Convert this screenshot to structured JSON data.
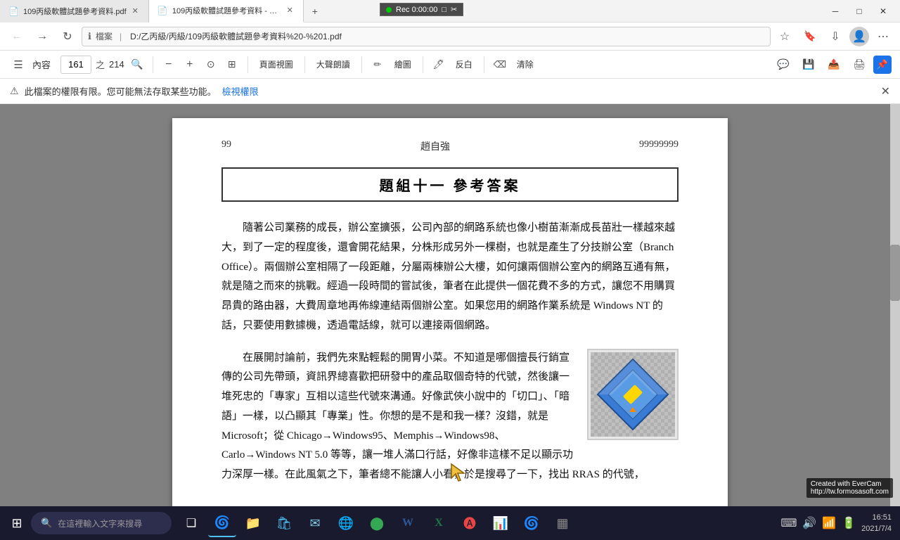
{
  "window": {
    "tabs": [
      {
        "id": "tab1",
        "title": "109丙級軟體試題參考資料.pdf",
        "active": false,
        "icon": "pdf"
      },
      {
        "id": "tab2",
        "title": "109丙級軟體試題參考資料 - 1.p...",
        "active": true,
        "icon": "pdf"
      }
    ],
    "controls": {
      "minimize": "─",
      "maximize": "□",
      "close": "✕"
    }
  },
  "recording": {
    "indicator": "●",
    "time": "Rec 0:00:00",
    "icons": [
      "□",
      "✂"
    ]
  },
  "browser": {
    "back": "←",
    "forward": "→",
    "refresh": "↻",
    "address_label": "檔案",
    "address_info_icon": "ℹ",
    "address_path": "D:/乙丙級/丙級/109丙級軟體試題參考資料%20-%201.pdf",
    "star_icon": "☆",
    "bookmark_icon": "🔖",
    "download_icon": "⬇",
    "profile_icon": "👤",
    "more_icon": "⋯"
  },
  "pdf_toolbar": {
    "sidebar_icon": "☰",
    "sidebar_label": "內容",
    "page_current": "161",
    "page_total": "214",
    "search_icon": "🔍",
    "zoom_out": "−",
    "zoom_in": "+",
    "zoom_fit": "⊙",
    "zoom_width": "⊞",
    "page_view_label": "頁面視圖",
    "read_aloud_label": "大聲朗讀",
    "draw_label": "繪圖",
    "reverse_label": "反白",
    "erase_label": "清除",
    "comment_icon": "💬",
    "save_icon": "💾",
    "share_icon": "📤",
    "print_icon": "🖨",
    "pin_icon": "📌"
  },
  "permission_bar": {
    "icon": "⚠",
    "message": "此檔案的權限有限。您可能無法存取某些功能。",
    "link_text": "檢視權限",
    "close_icon": "✕"
  },
  "pdf_content": {
    "page_left": "99",
    "page_center": "趙自強",
    "page_right": "99999999",
    "section_title": "題組十一   參考答案",
    "paragraph1": "隨著公司業務的成長，辦公室擴張，公司內部的網路系統也像小樹苗漸漸成長苗壯一樣越來越大，到了一定的程度後，還會開花結果，分株形成另外一棵樹，也就是產生了分技辦公室（Branch Office）。兩個辦公室相隔了一段距離，分屬兩棟辦公大樓，如何讓兩個辦公室內的網路互通有無，就是隨之而來的挑戰。經過一段時間的嘗試後，筆者在此提供一個花費不多的方式，讓您不用購買昂貴的路由器，大費周章地再佈線連結兩個辦公室。如果您用的網路作業系統是 Windows NT 的話，只要使用數據機，透過電話線，就可以連接兩個網路。",
    "paragraph2": "在展開討論前，我們先來點輕鬆的開胃小菜。不知道是哪個擅長行銷宣傳的公司先帶頭，資訊界總喜歡把研發中的產品取個奇特的代號，然後讓一堆死忠的「專家」互相以這些代號來溝通。好像武俠小說中的「切口」、「暗語」一樣，以凸顯其「專業」性。你想的是不是和我一樣？沒錯，就是 Microsoft；從 Chicago→Windows95、Memphis→Windows98、Carlo→Windows NT 5.0 等等，讓一堆人滿口行話，好像非這樣不足以顯示功力深厚一樣。在此風氣之下，筆者總不能讓人小看，於是搜尋了一下，找出 RRAS 的代號，"
  },
  "taskbar": {
    "start_icon": "⊞",
    "search_placeholder": "在這裡輸入文字來搜尋",
    "search_icon": "🔍",
    "apps": [
      {
        "id": "task-view",
        "icon": "❑",
        "label": "Task View"
      },
      {
        "id": "edge",
        "icon": "🌀",
        "label": "Edge",
        "active": true
      },
      {
        "id": "explorer",
        "icon": "📁",
        "label": "File Explorer"
      },
      {
        "id": "store",
        "icon": "🛍",
        "label": "Microsoft Store"
      },
      {
        "id": "mail",
        "icon": "✉",
        "label": "Mail"
      },
      {
        "id": "browser2",
        "icon": "🌐",
        "label": "Browser"
      },
      {
        "id": "chrome",
        "icon": "⬤",
        "label": "Chrome"
      },
      {
        "id": "word",
        "icon": "W",
        "label": "Word"
      },
      {
        "id": "excel",
        "icon": "X",
        "label": "Excel"
      },
      {
        "id": "app1",
        "icon": "A",
        "label": "App1"
      },
      {
        "id": "app2",
        "icon": "M",
        "label": "App2"
      },
      {
        "id": "edge2",
        "icon": "e",
        "label": "Edge2"
      },
      {
        "id": "tablet",
        "icon": "▦",
        "label": "Tablet"
      }
    ],
    "system_tray": {
      "icons": [
        "⌨",
        "🔊",
        "📶",
        "🔋"
      ],
      "datetime": "2021/7/4",
      "time": "16:51"
    }
  },
  "evercam": {
    "line1": "Created  with  EverCam",
    "line2": "http://tw.formosasoft.com"
  },
  "colors": {
    "toolbar_bg": "#ffffff",
    "page_bg": "#808080",
    "pdf_bg": "#ffffff",
    "accent": "#1a73e8",
    "taskbar_bg": "#1e1e2e",
    "tab_active_bg": "#ffffff",
    "tab_inactive_bg": "#e0e0e0"
  }
}
